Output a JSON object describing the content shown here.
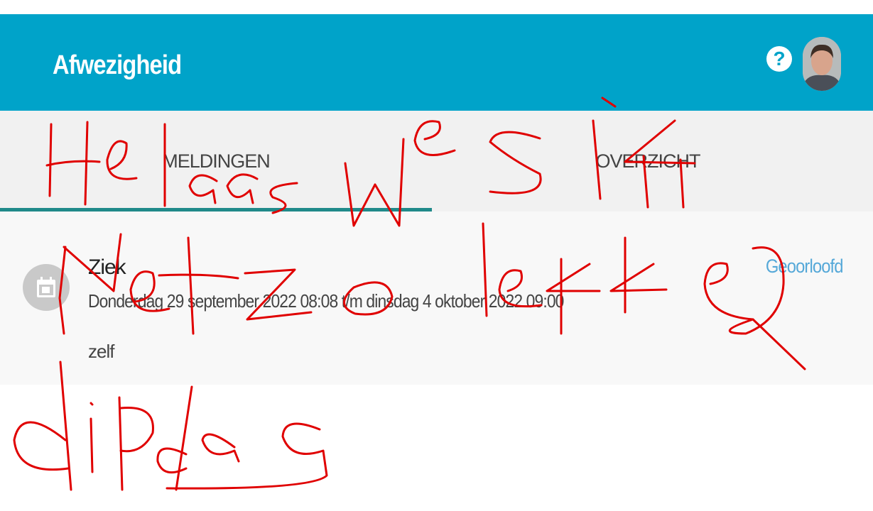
{
  "header": {
    "title": "Afwezigheid",
    "help_label": "?",
    "background_color": "#00a3c9"
  },
  "tabs": [
    {
      "label": "MELDINGEN",
      "active": true
    },
    {
      "label": "OVERZICHT",
      "active": false
    }
  ],
  "melding": {
    "icon": "calendar-icon",
    "type": "Ziek",
    "dates": "Donderdag 29 september 2022 08:08 t/m dinsdag 4 oktober 2022 09:00",
    "by": "zelf",
    "status": "Geoorloofd",
    "status_color": "#55a8d8"
  },
  "annotation": {
    "color": "#e00000",
    "text": "Helaas was ik niet zo lekker die dag"
  }
}
